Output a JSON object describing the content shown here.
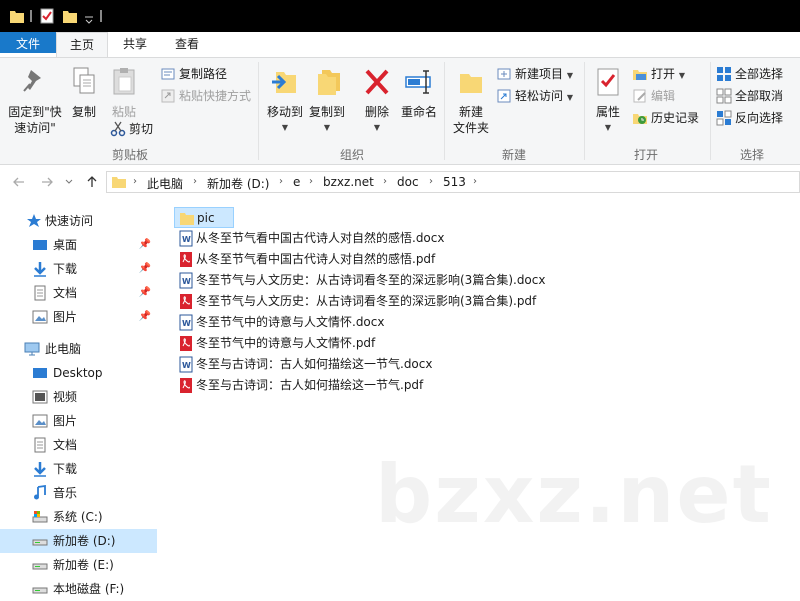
{
  "tabs": {
    "file": "文件",
    "home": "主页",
    "share": "共享",
    "view": "查看"
  },
  "clipboard": {
    "pin": "固定到\"快\n速访问\"",
    "copy": "复制",
    "paste": "粘贴",
    "copy_path": "复制路径",
    "paste_shortcut": "粘贴快捷方式",
    "cut": "剪切",
    "label": "剪贴板"
  },
  "organize": {
    "move_to": "移动到",
    "copy_to": "复制到",
    "delete": "删除",
    "rename": "重命名",
    "label": "组织"
  },
  "new": {
    "new_folder": "新建\n文件夹",
    "new_item": "新建项目",
    "easy_access": "轻松访问",
    "label": "新建"
  },
  "open": {
    "properties": "属性",
    "open": "打开",
    "edit": "编辑",
    "history": "历史记录",
    "label": "打开"
  },
  "select": {
    "select_all": "全部选择",
    "select_none": "全部取消",
    "invert": "反向选择",
    "label": "选择"
  },
  "address": {
    "crumbs": [
      "此电脑",
      "新加卷 (D:)",
      "e",
      "bzxz.net",
      "doc",
      "513"
    ]
  },
  "nav": {
    "quick_access": "快速访问",
    "desktop": "桌面",
    "downloads": "下载",
    "documents": "文档",
    "pictures": "图片",
    "this_pc": "此电脑",
    "pc_desktop": "Desktop",
    "videos": "视频",
    "pc_pictures": "图片",
    "pc_documents": "文档",
    "pc_downloads": "下载",
    "music": "音乐",
    "drive_c": "系统 (C:)",
    "drive_d": "新加卷 (D:)",
    "drive_e": "新加卷 (E:)",
    "drive_f": "本地磁盘 (F:)"
  },
  "files": [
    {
      "name": "pic",
      "type": "folder"
    },
    {
      "name": "从冬至节气看中国古代诗人对自然的感悟.docx",
      "type": "docx"
    },
    {
      "name": "从冬至节气看中国古代诗人对自然的感悟.pdf",
      "type": "pdf"
    },
    {
      "name": "冬至节气与人文历史：从古诗词看冬至的深远影响(3篇合集).docx",
      "type": "docx"
    },
    {
      "name": "冬至节气与人文历史：从古诗词看冬至的深远影响(3篇合集).pdf",
      "type": "pdf"
    },
    {
      "name": "冬至节气中的诗意与人文情怀.docx",
      "type": "docx"
    },
    {
      "name": "冬至节气中的诗意与人文情怀.pdf",
      "type": "pdf"
    },
    {
      "name": "冬至与古诗词：古人如何描绘这一节气.docx",
      "type": "docx"
    },
    {
      "name": "冬至与古诗词：古人如何描绘这一节气.pdf",
      "type": "pdf"
    }
  ],
  "watermark": "bzxz.net",
  "colors": {
    "accent": "#1979ca",
    "selection": "#cce8ff",
    "folder": "#f8d775",
    "pdf": "#d9232e",
    "word": "#2b579a"
  }
}
